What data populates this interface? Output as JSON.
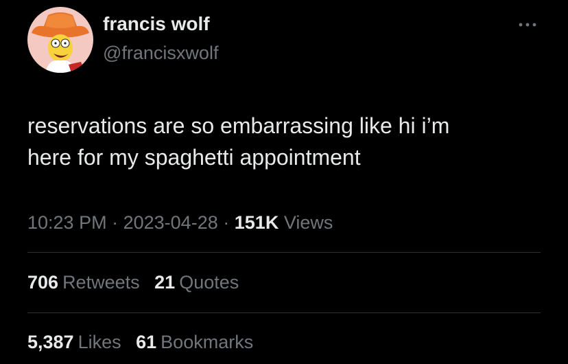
{
  "tweet": {
    "author": {
      "display_name": "francis wolf",
      "handle": "@francisxwolf",
      "avatar_icon": "cartoon-character-cowboy-hat-avatar-icon"
    },
    "more_icon": "more-horizontal-icon",
    "text_lines": [
      "reservations are so embarrassing like hi i’m",
      "here for my spaghetti appointment"
    ],
    "time": "10:23 PM",
    "separator": "·",
    "date": "2023-04-28",
    "views_count": "151K",
    "views_label": "Views"
  },
  "stats": {
    "retweets_count": "706",
    "retweets_label": "Retweets",
    "quotes_count": "21",
    "quotes_label": "Quotes",
    "likes_count": "5,387",
    "likes_label": "Likes",
    "bookmarks_count": "61",
    "bookmarks_label": "Bookmarks"
  },
  "colors": {
    "background": "#000000",
    "primary_text": "#e7e9ea",
    "secondary_text": "#71767b",
    "divider": "#2f3336"
  }
}
